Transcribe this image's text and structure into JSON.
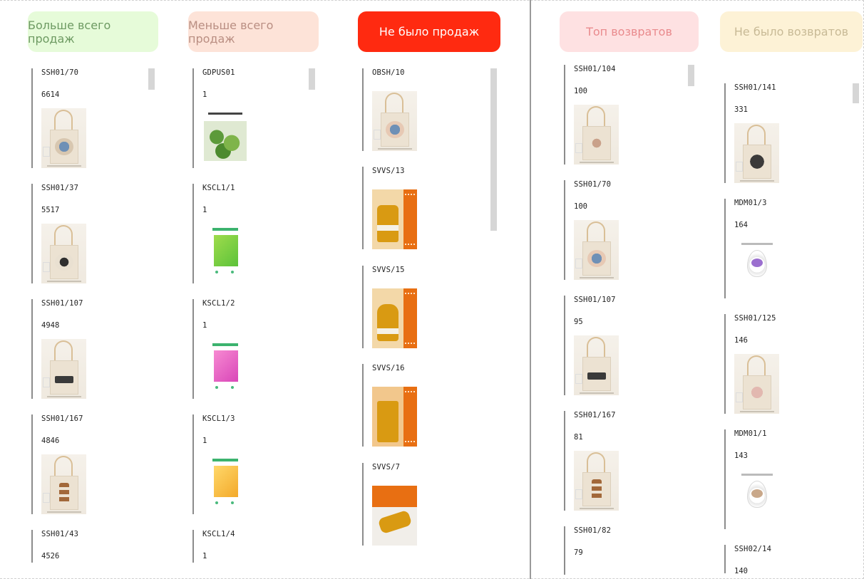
{
  "headers": {
    "most_sales": {
      "label": "Больше всего продаж",
      "bg": "#e6fbd9",
      "fg": "#6d9a62"
    },
    "least_sales": {
      "label": "Меньше всего продаж",
      "bg": "#fde3d8",
      "fg": "#b98e82"
    },
    "no_sales": {
      "label": "Не было продаж",
      "bg": "#ff2a10",
      "fg": "#ffffff"
    },
    "top_returns": {
      "label": "Топ возвратов",
      "bg": "#fee1e2",
      "fg": "#e98a8d"
    },
    "no_returns": {
      "label": "Не было возвратов",
      "bg": "#fdf2d6",
      "fg": "#c8ba96"
    }
  },
  "most_sales": [
    {
      "code": "SSH01/70",
      "value": "6614",
      "thumb": "tote-wave-print"
    },
    {
      "code": "SSH01/37",
      "value": "5517",
      "thumb": "tote-panda-print"
    },
    {
      "code": "SSH01/107",
      "value": "4948",
      "thumb": "tote-eyes-print"
    },
    {
      "code": "SSH01/167",
      "value": "4846",
      "thumb": "tote-butterfly-print"
    },
    {
      "code": "SSH01/43",
      "value": "4526",
      "thumb": ""
    }
  ],
  "least_sales": [
    {
      "code": "GDPUS01",
      "value": "1",
      "thumb": "plant-booklet"
    },
    {
      "code": "KSCL1/1",
      "value": "1",
      "thumb": "green-packet"
    },
    {
      "code": "KSCL1/2",
      "value": "1",
      "thumb": "pink-packet"
    },
    {
      "code": "KSCL1/3",
      "value": "1",
      "thumb": "yellow-packet"
    },
    {
      "code": "KSCL1/4",
      "value": "1",
      "thumb": ""
    }
  ],
  "no_sales": [
    {
      "code": "OBSH/10",
      "thumb": "tote-wave-print"
    },
    {
      "code": "SVVS/13",
      "thumb": "beeswax-candle"
    },
    {
      "code": "SVVS/15",
      "thumb": "beeswax-candle"
    },
    {
      "code": "SVVS/16",
      "thumb": "beeswax-candle"
    },
    {
      "code": "SVVS/7",
      "thumb": "beeswax-roll"
    }
  ],
  "top_returns": [
    {
      "code": "SSH01/104",
      "value": "100",
      "thumb": "tote-floral-print"
    },
    {
      "code": "SSH01/70",
      "value": "100",
      "thumb": "tote-wave-print"
    },
    {
      "code": "SSH01/107",
      "value": "95",
      "thumb": "tote-eyes-print"
    },
    {
      "code": "SSH01/167",
      "value": "81",
      "thumb": "tote-butterfly-print"
    },
    {
      "code": "SSH01/82",
      "value": "79",
      "thumb": ""
    }
  ],
  "no_returns": [
    {
      "code": "SSH01/141",
      "value": "331",
      "thumb": "tote-dark-print"
    },
    {
      "code": "MDM01/3",
      "value": "164",
      "thumb": "egg-purple"
    },
    {
      "code": "SSH01/125",
      "value": "146",
      "thumb": "tote-pink-print"
    },
    {
      "code": "MDM01/1",
      "value": "143",
      "thumb": "egg-tan"
    },
    {
      "code": "SSH02/14",
      "value": "140",
      "thumb": ""
    }
  ]
}
